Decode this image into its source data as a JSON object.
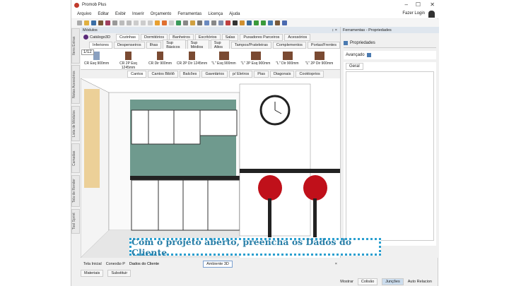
{
  "app": {
    "title": "Promob Plus",
    "login": "Fazer Login"
  },
  "menu": [
    "Arquivo",
    "Editar",
    "Exibir",
    "Inserir",
    "Orçamento",
    "Ferramentas",
    "Licença",
    "Ajuda"
  ],
  "panels": {
    "left_title": "Módulos",
    "left_controls": "↕ ×",
    "right_title": "Ferramentas - Propriedades"
  },
  "catalog": {
    "name": "Catálogo3D",
    "tabs": [
      "Cozinhas",
      "Dormitórios",
      "Banheiros",
      "Escritórios",
      "Salas",
      "Puxadores Parceiros",
      "Acessórios"
    ],
    "active": "Cozinhas"
  },
  "subtabs": [
    "Inferiores",
    "Despenseiros",
    "Ilhas",
    "Sup Básicos",
    "Sup Médios",
    "Sup Altos",
    "Tampos/Prateleiras",
    "Complementos",
    "Portas/Frentes"
  ],
  "page_indicator": "1/12",
  "items": [
    "CR Esq 900mm",
    "CR 2P Esq 1245mm",
    "CR Dir 900mm",
    "CR 2P Dir 1245mm",
    "\"L\" Esq 900mm",
    "\"L\" 2P Esq 900mm",
    "\"L\" Dir 900mm",
    "\"L\" 2P Dir 900mm"
  ],
  "bottom_tabs": [
    "Cantos",
    "Cantos Bibliô",
    "Balcões",
    "Gavetários",
    "p/ Eletros",
    "Pias",
    "Diagonais",
    "Cooktoprios"
  ],
  "vertical_tabs": [
    "Itens Extras",
    "Notas Acessórios",
    "Lista de Módulos",
    "Camadas",
    "Tela de Render",
    "Tool Sprint"
  ],
  "properties": {
    "header": "Propriedades",
    "advanced": "Avançado",
    "tab": "Geral"
  },
  "doc_tabs": [
    "Tela Inicial",
    "Conexão P",
    "Dados do Cliente",
    "Ambiente 3D"
  ],
  "lower_tabs": [
    "Materiais",
    "Substituir"
  ],
  "status": [
    "Mostrar",
    "Colisão",
    "Junções",
    "Auto Relacion"
  ],
  "caption": "Com o projeto aberto, preencha os Dados do Cliente"
}
